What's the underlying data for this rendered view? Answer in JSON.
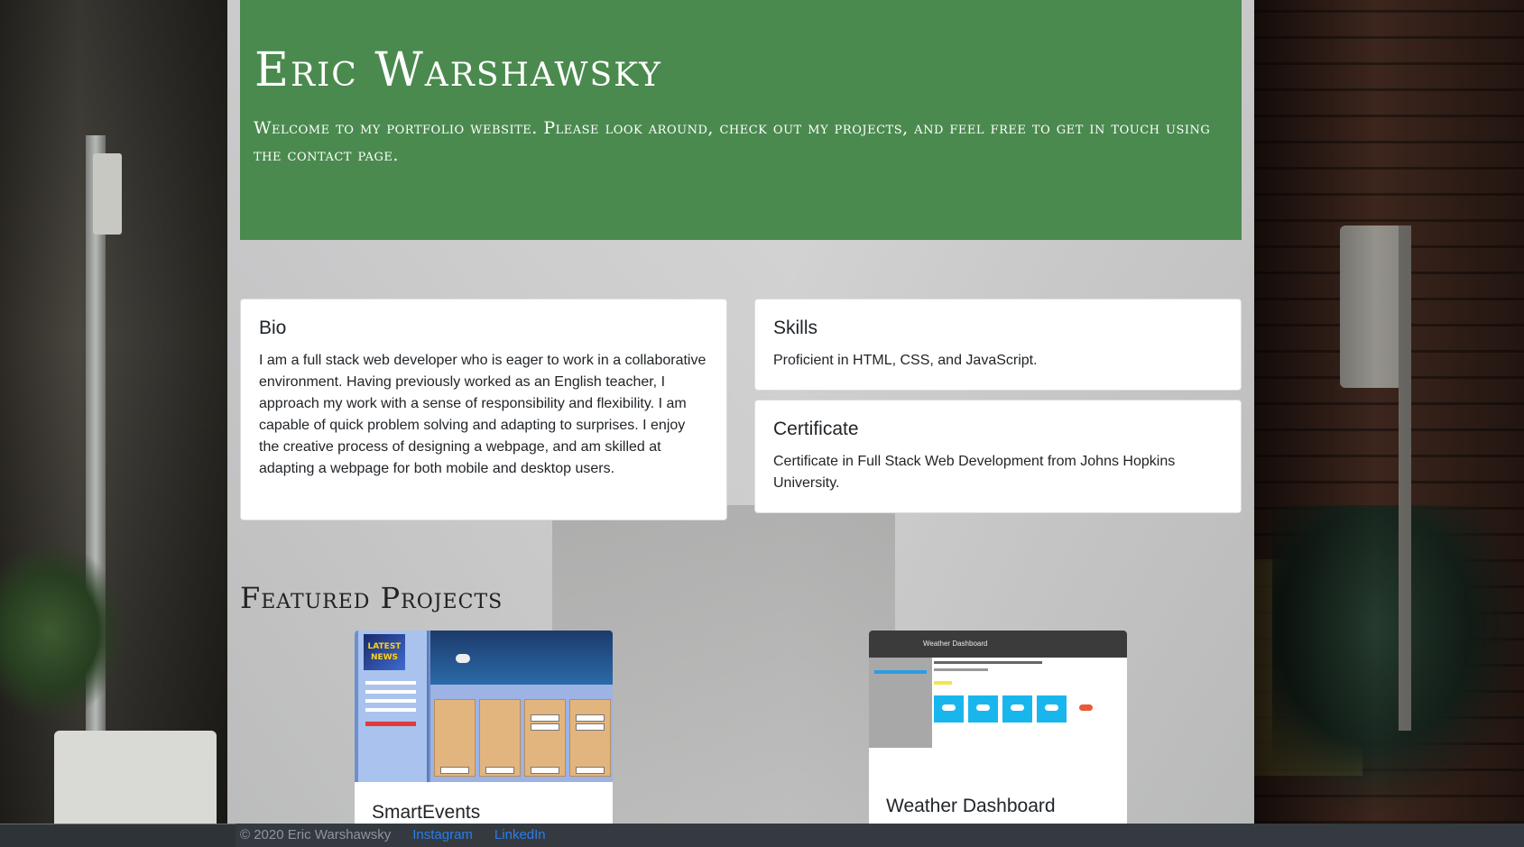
{
  "header": {
    "name": "Eric Warshawsky",
    "tagline": "Welcome to my portfolio website. Please look around, check out my projects, and feel free to get in touch using the contact page."
  },
  "cards": {
    "bio": {
      "title": "Bio",
      "text": "I am a full stack web developer who is eager to work in a collaborative environment. Having previously worked as an English teacher, I approach my work with a sense of responsibility and flexibility. I am capable of quick problem solving and adapting to surprises. I enjoy the creative process of designing a webpage, and am skilled at adapting a webpage for both mobile and desktop users."
    },
    "skills": {
      "title": "Skills",
      "text": "Proficient in HTML, CSS, and JavaScript."
    },
    "certificate": {
      "title": "Certificate",
      "text": "Certificate in Full Stack Web Development from Johns Hopkins University."
    }
  },
  "featured": {
    "heading": "Featured Projects",
    "projects": [
      {
        "name": "SmartEvents",
        "logo_text": "LATEST NEWS"
      },
      {
        "name": "Weather Dashboard",
        "bar_text": "Weather Dashboard"
      }
    ]
  },
  "footer": {
    "copyright": "© 2020 Eric Warshawsky",
    "links": [
      "Instagram",
      "LinkedIn"
    ]
  },
  "colors": {
    "jumbotron": "#4a8a4e",
    "footer": "#343a40",
    "link": "#2b7de9"
  }
}
